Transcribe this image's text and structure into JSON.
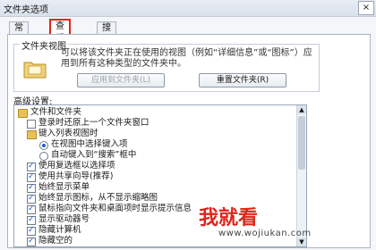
{
  "window": {
    "title": "文件夹选项",
    "close_glyph": "×"
  },
  "tabs": [
    {
      "label": "常规"
    },
    {
      "label": "查看"
    },
    {
      "label": "搜索"
    }
  ],
  "folder_views": {
    "title": "文件夹视图",
    "description": "可以将该文件夹正在使用的视图（例如“详细信息”或“图标”）应用到所有这种类型的文件夹中。",
    "apply_button": "应用到文件夹(L)",
    "reset_button": "重置文件夹(R)"
  },
  "advanced": {
    "label": "高级设置:",
    "items": [
      {
        "type": "folder",
        "label": "文件和文件夹"
      },
      {
        "type": "checkbox",
        "checked": false,
        "label": "登录时还原上一个文件夹窗口"
      },
      {
        "type": "folder",
        "label": "键入列表视图时"
      },
      {
        "type": "radio",
        "checked": true,
        "label": "在视图中选择键入项"
      },
      {
        "type": "radio",
        "checked": false,
        "label": "自动键入到“搜索”框中"
      },
      {
        "type": "checkbox",
        "checked": true,
        "label": "使用复选框以选择项"
      },
      {
        "type": "checkbox",
        "checked": true,
        "label": "使用共享向导(推荐)"
      },
      {
        "type": "checkbox",
        "checked": true,
        "label": "始终显示菜单"
      },
      {
        "type": "checkbox",
        "checked": true,
        "label": "始终显示图标，从不显示缩略图"
      },
      {
        "type": "checkbox",
        "checked": true,
        "label": "鼠标指向文件夹和桌面项时显示提示信息"
      },
      {
        "type": "checkbox",
        "checked": true,
        "label": "显示驱动器号"
      },
      {
        "type": "checkbox",
        "checked": true,
        "label": "隐藏计算机"
      },
      {
        "type": "checkbox",
        "checked": true,
        "label": "隐藏空的"
      }
    ]
  },
  "watermark": {
    "text": "我就看",
    "url": "www.wojiukan.com"
  }
}
